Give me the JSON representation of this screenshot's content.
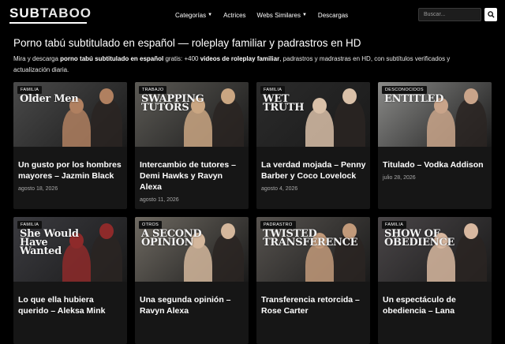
{
  "brand": {
    "logo_a": "SUB",
    "logo_b": "TABOO"
  },
  "nav": [
    {
      "label": "Categorías",
      "caret": true
    },
    {
      "label": "Actrices",
      "caret": false
    },
    {
      "label": "Webs Similares",
      "caret": true
    },
    {
      "label": "Descargas",
      "caret": false
    }
  ],
  "search": {
    "placeholder": "Buscar..."
  },
  "page": {
    "title": "Porno tabú subtitulado en español — roleplay familiar y padrastros en HD",
    "intro_1": "Mira y descarga ",
    "intro_b1": "porno tabú subtitulado en español",
    "intro_2": " gratis: +400 ",
    "intro_b2": "videos de roleplay familiar",
    "intro_3": ", padrastros y madrastras en HD, con subtítulos verificados y actualización diaria."
  },
  "cards": [
    {
      "badge": "FAMILIA",
      "poster": "Older Men",
      "title": "Un gusto por los hombres mayores – Jazmin Black",
      "date": "agosto 18, 2026",
      "bg": "#4a4a4a",
      "accent": "#b08060"
    },
    {
      "badge": "TRABAJO",
      "poster": "SWAPPING TUTORS",
      "title": "Intercambio de tutores – Demi Hawks y Ravyn Alexa",
      "date": "agosto 11, 2026",
      "bg": "#5c5a55",
      "accent": "#caa682"
    },
    {
      "badge": "FAMILIA",
      "poster": "WET TRUTH",
      "title": "La verdad mojada – Penny Barber y Coco Lovelock",
      "date": "agosto 4, 2026",
      "bg": "#2b2b2b",
      "accent": "#d9c0a8"
    },
    {
      "badge": "DESCONOCIDOS",
      "poster": "ENTITLED",
      "title": "Titulado – Vodka Addison",
      "date": "julio 28, 2026",
      "bg": "#8a8a88",
      "accent": "#c9a48a"
    },
    {
      "badge": "FAMILIA",
      "poster": "She Would Have Wanted",
      "title": "Lo que ella hubiera querido – Aleksa Mink",
      "date": "",
      "bg": "#3b3b40",
      "accent": "#8e2a2a"
    },
    {
      "badge": "OTROS",
      "poster": "A SECOND OPINION",
      "title": "Una segunda opinión – Ravyn Alexa",
      "date": "",
      "bg": "#6f6a62",
      "accent": "#d4b79c"
    },
    {
      "badge": "PADRASTRO",
      "poster": "TWISTED TRANSFERENCE",
      "title": "Transferencia retorcida – Rose Carter",
      "date": "",
      "bg": "#57534f",
      "accent": "#c29a7a"
    },
    {
      "badge": "FAMILIA",
      "poster": "SHOW OF OBEDIENCE",
      "title": "Un espectáculo de obediencia – Lana",
      "date": "",
      "bg": "#4a4648",
      "accent": "#d8b8a0"
    }
  ],
  "colors": {
    "background": "#000000",
    "card": "#161616",
    "badge": "#111111",
    "date": "#a8a8a8"
  }
}
